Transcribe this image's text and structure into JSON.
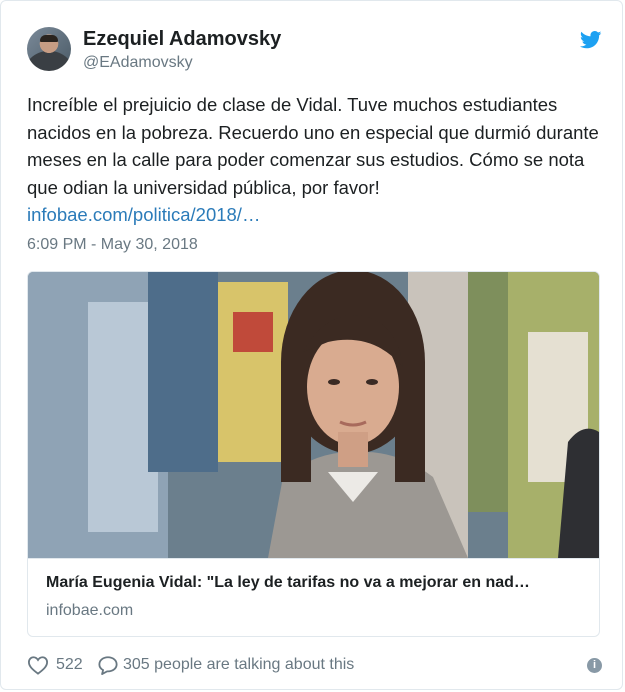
{
  "author": {
    "name": "Ezequiel Adamovsky",
    "handle": "@EAdamovsky"
  },
  "tweet": {
    "text": "Increíble el prejuicio de clase de Vidal. Tuve muchos estudiantes nacidos en la pobreza. Recuerdo uno en especial que durmió durante meses en la calle para poder comenzar sus estudios. Cómo se nota que odian la universidad pública, por favor! ",
    "link_text": "infobae.com/politica/2018/…",
    "timestamp": "6:09 PM - May 30, 2018"
  },
  "card": {
    "title": "María Eugenia Vidal: \"La ley de tarifas no va a mejorar en nad…",
    "domain": "infobae.com"
  },
  "actions": {
    "likes": "522",
    "talking": "305 people are talking about this"
  },
  "icons": {
    "brand": "twitter-bird-icon",
    "like": "heart-icon",
    "reply": "speech-bubble-icon",
    "info": "info-icon"
  },
  "colors": {
    "link": "#2b7bb9",
    "brand": "#1da1f2",
    "secondary_text": "#697882",
    "border": "#e1e8ed"
  }
}
